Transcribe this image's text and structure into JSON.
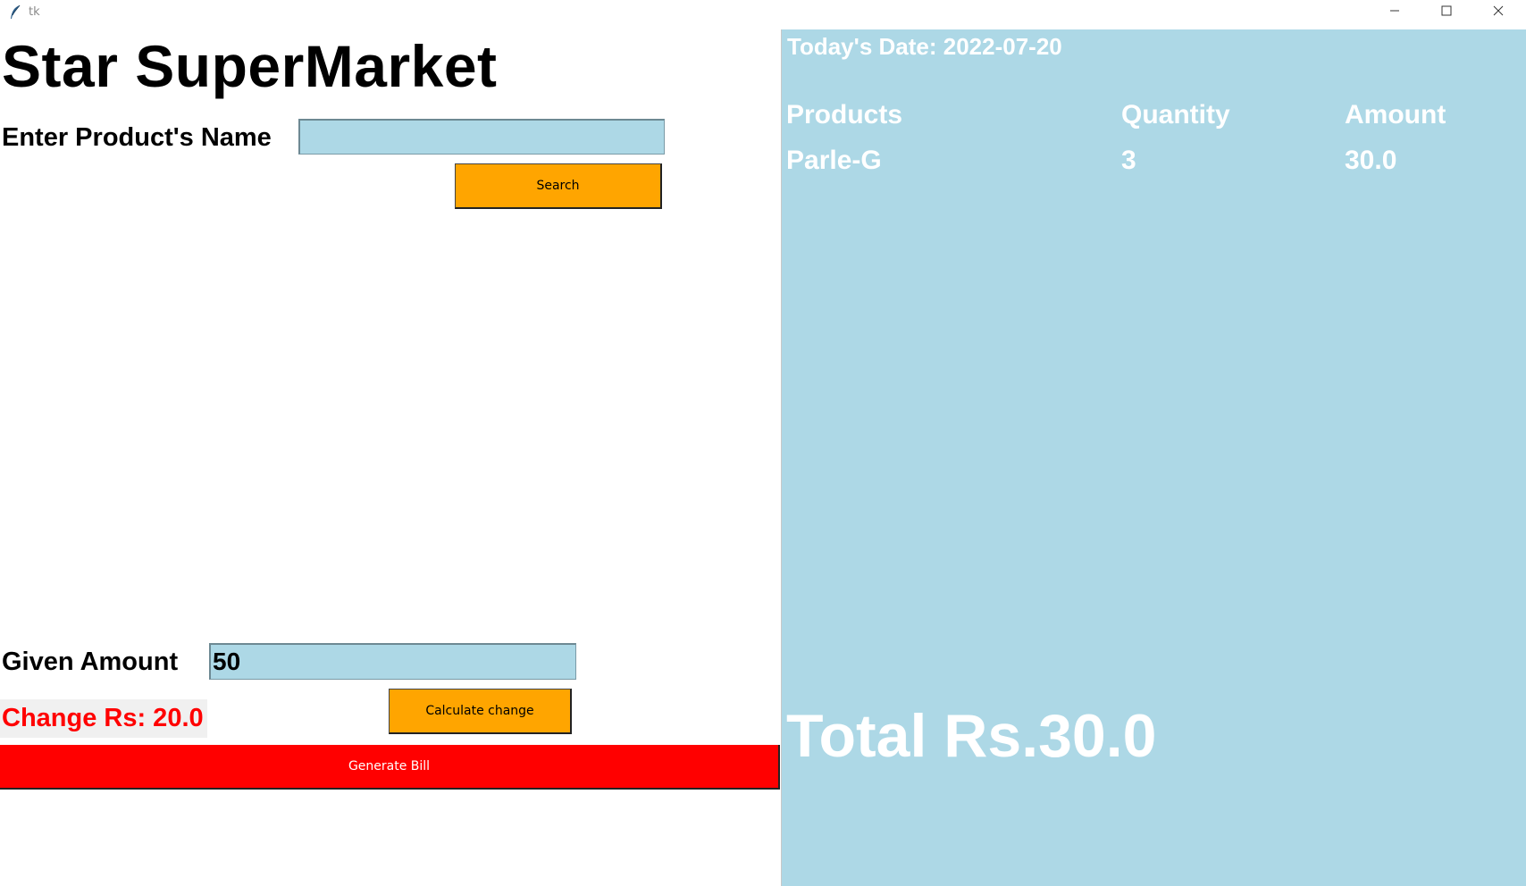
{
  "window": {
    "title": "tk"
  },
  "store": {
    "title": "Star SuperMarket"
  },
  "search": {
    "label": "Enter Product's Name",
    "value": "",
    "button_label": "Search"
  },
  "payment": {
    "given_label": "Given Amount",
    "given_value": "50",
    "change_text": "Change Rs: 20.0",
    "calc_button_label": "Calculate change",
    "generate_button_label": "Generate Bill"
  },
  "bill": {
    "date_text": "Today's Date: 2022-07-20",
    "headers": {
      "products": "Products",
      "quantity": "Quantity",
      "amount": "Amount"
    },
    "items": [
      {
        "product": "Parle-G",
        "quantity": "3",
        "amount": "30.0"
      }
    ],
    "total_text": "Total Rs.30.0"
  },
  "colors": {
    "panel_bg": "#add8e6",
    "button_orange": "#ffa500",
    "generate_red": "#ff0000",
    "change_text_red": "#ff0000"
  },
  "icons": {
    "app": "feather-icon",
    "minimize": "minimize-icon",
    "maximize": "maximize-icon",
    "close": "close-icon"
  }
}
